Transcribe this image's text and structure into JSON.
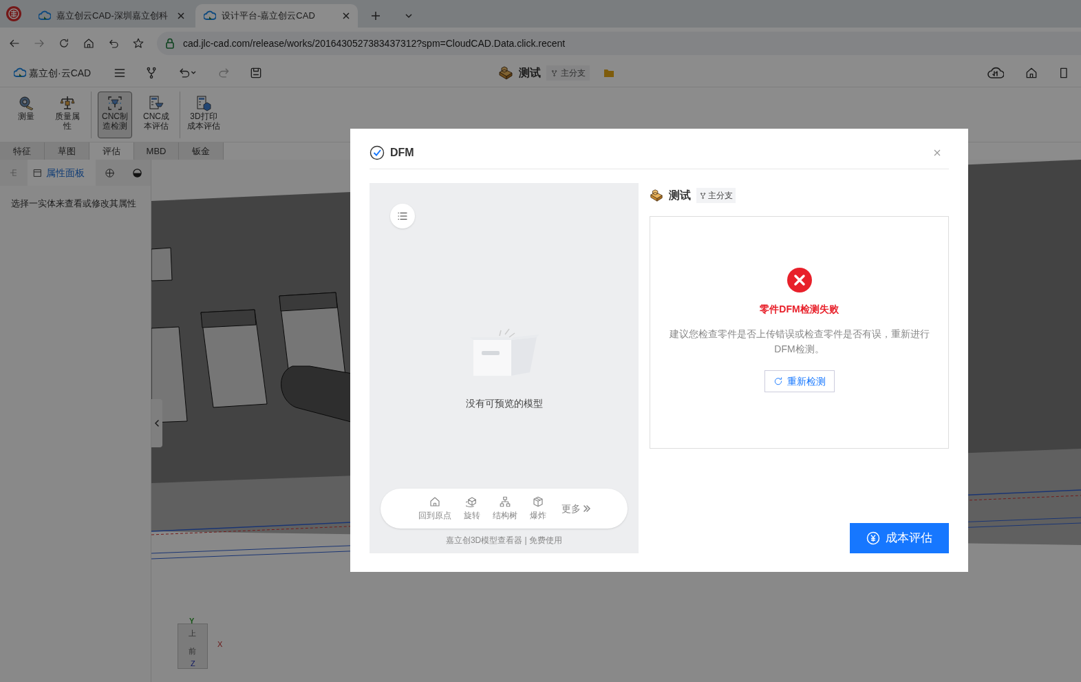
{
  "browser": {
    "tabs": [
      {
        "title": "嘉立创云CAD-深圳嘉立创科",
        "selected": false
      },
      {
        "title": "设计平台-嘉立创云CAD",
        "selected": true
      }
    ],
    "url": "cad.jlc-cad.com/release/works/2016430527383437312?spm=CloudCAD.Data.click.recent"
  },
  "app_header": {
    "logo": "嘉立创·云CAD",
    "project": "测试",
    "branch": "主分支"
  },
  "toolbar": {
    "tools": [
      {
        "label": "测量",
        "selected": false
      },
      {
        "label": "质量属性",
        "selected": false
      },
      {
        "label": "CNC制造检测",
        "selected": true
      },
      {
        "label": "CNC成本评估",
        "selected": false
      },
      {
        "label": "3D打印成本评估",
        "selected": false
      }
    ]
  },
  "module_tabs": [
    {
      "label": "特征",
      "selected": false
    },
    {
      "label": "草图",
      "selected": false
    },
    {
      "label": "评估",
      "selected": true
    },
    {
      "label": "MBD",
      "selected": false
    },
    {
      "label": "钣金",
      "selected": false
    }
  ],
  "side_panel": {
    "tab": "属性面板",
    "hint": "选择一实体来查看或修改其属性"
  },
  "view_cube": {
    "labels": [
      "Y",
      "上",
      "X",
      "前",
      "Z"
    ]
  },
  "dialog": {
    "title": "DFM",
    "preview": {
      "empty_text": "没有可预览的模型",
      "tools": [
        "回到原点",
        "旋转",
        "结构树",
        "爆炸"
      ],
      "more": "更多",
      "footer": "嘉立创3D模型查看器 | 免费使用"
    },
    "project": "测试",
    "branch": "主分支",
    "result": {
      "kind": "failed",
      "title": "零件DFM检测失败",
      "message": "建议您检查零件是否上传错误或检查零件是否有误，重新进行DFM检测。",
      "retry": "重新检测"
    },
    "primary_button": "成本评估"
  }
}
